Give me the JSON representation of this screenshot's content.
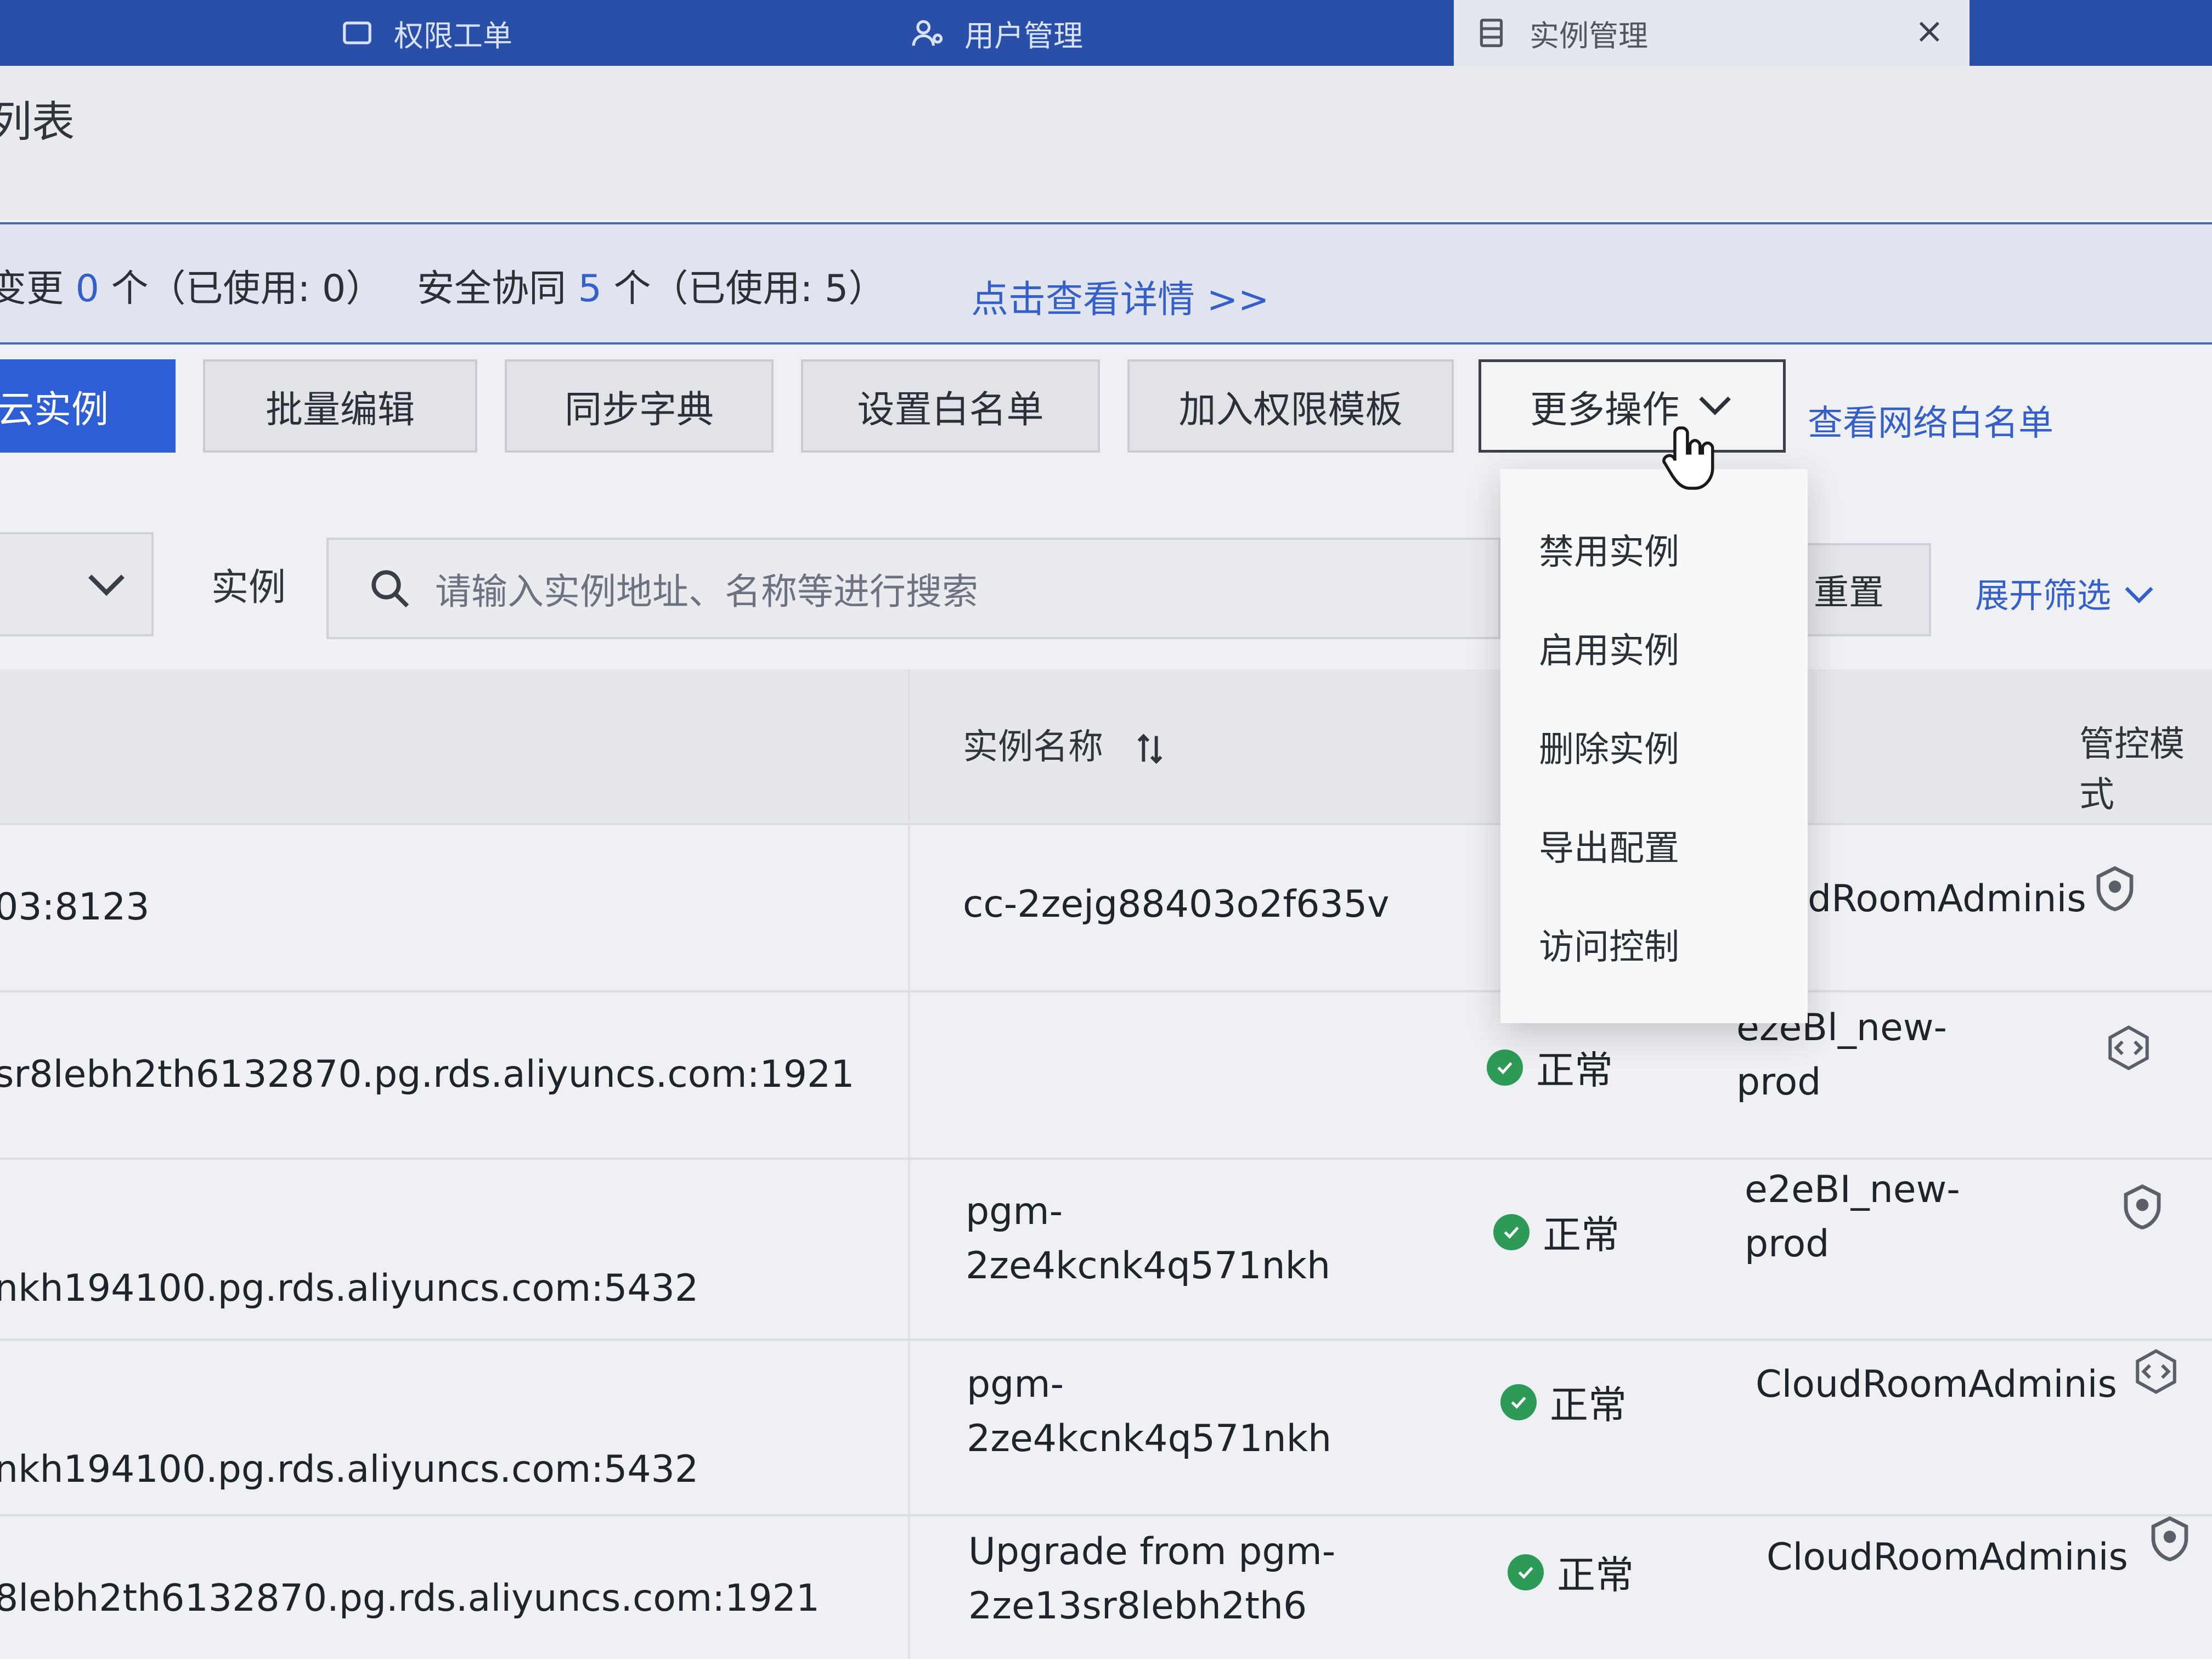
{
  "tabs": [
    {
      "label": "权限工单",
      "icon": "ticket-icon"
    },
    {
      "label": "用户管理",
      "icon": "user-icon"
    },
    {
      "label": "实例管理",
      "icon": "database-icon"
    }
  ],
  "page_title": "列表",
  "info": {
    "change_prefix": "变更",
    "change_count": "0",
    "change_suffix": "个（已使用: 0）",
    "security_prefix": "安全协同",
    "security_count": "5",
    "security_suffix": "个（已使用: 5）",
    "detail_link": "点击查看详情 >>"
  },
  "toolbar": {
    "add_instance": "云实例",
    "batch_edit": "批量编辑",
    "sync_dict": "同步字典",
    "set_whitelist": "设置白名单",
    "add_perm_template": "加入权限模板",
    "more_actions": "更多操作",
    "view_net_whitelist": "查看网络白名单"
  },
  "more_menu": [
    "禁用实例",
    "启用实例",
    "删除实例",
    "导出配置",
    "访问控制"
  ],
  "filter": {
    "type_label": "实例",
    "search_placeholder": "请输入实例地址、名称等进行搜索",
    "reset": "重置",
    "expand_filter": "展开筛选"
  },
  "table": {
    "headers": {
      "name": "实例名称",
      "control_mode": "管控模式"
    },
    "rows": [
      {
        "address": "03:8123",
        "name": [
          "cc-2zejg88403o2f635v"
        ],
        "status": "",
        "owner": [
          "dRoomAdminis"
        ]
      },
      {
        "address": "sr8lebh2th6132870.pg.rds.aliyuncs.com:1921",
        "name": [],
        "status": "正常",
        "owner": [
          "ezeBl_new-",
          "prod"
        ]
      },
      {
        "address": "nkh194100.pg.rds.aliyuncs.com:5432",
        "name": [
          "pgm-",
          "2ze4kcnk4q571nkh"
        ],
        "status": "正常",
        "owner": [
          "e2eBI_new-",
          "prod"
        ]
      },
      {
        "address": "nkh194100.pg.rds.aliyuncs.com:5432",
        "name": [
          "pgm-",
          "2ze4kcnk4q571nkh"
        ],
        "status": "正常",
        "owner": [
          "CloudRoomAdminis"
        ]
      },
      {
        "address": "8lebh2th6132870.pg.rds.aliyuncs.com:1921",
        "name": [
          "Upgrade from pgm-",
          "2ze13sr8lebh2th6"
        ],
        "status": "正常",
        "owner": [
          "CloudRoomAdminis"
        ]
      }
    ]
  },
  "colors": {
    "primary": "#2e5ed6",
    "tabbar": "#2a4fa8",
    "success": "#2e9a57",
    "link": "#3560c9"
  }
}
